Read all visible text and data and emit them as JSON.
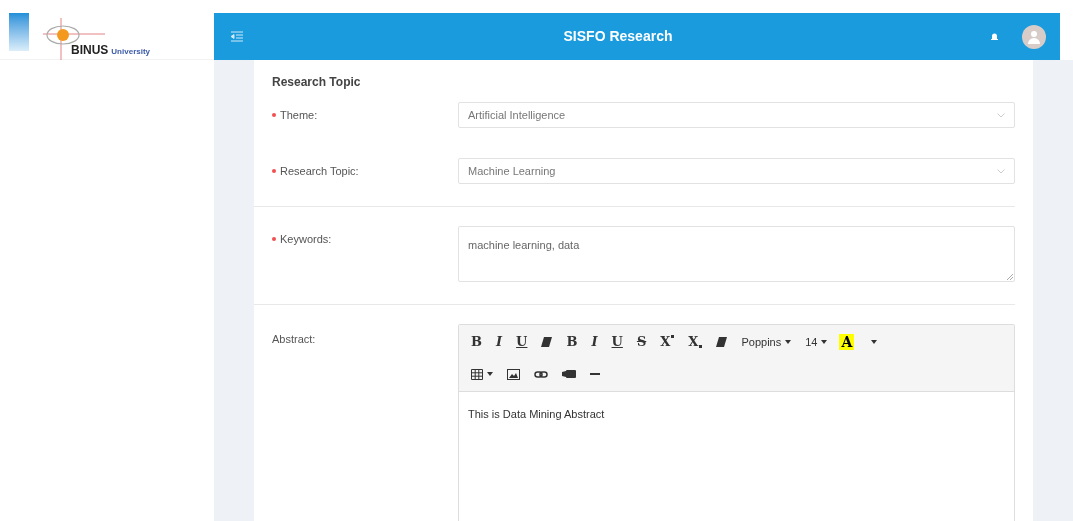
{
  "brand": {
    "name": "BINUS",
    "suffix": "University"
  },
  "header": {
    "title": "SISFO Research"
  },
  "section": {
    "title": "Research Topic"
  },
  "fields": [
    {
      "kind": "select",
      "label": "Theme:",
      "required": true,
      "value": "Artificial Intelligence",
      "divider_after": false
    },
    {
      "kind": "select",
      "label": "Research Topic:",
      "required": true,
      "value": "Machine Learning",
      "divider_after": true
    },
    {
      "kind": "textarea",
      "label": "Keywords:",
      "required": true,
      "value": "machine learning, data",
      "divider_after": true
    },
    {
      "kind": "editor",
      "label": "Abstract:",
      "required": false,
      "value": "This is Data Mining Abstract"
    }
  ],
  "toolbar": [
    [
      {
        "kind": "bold",
        "label": "B"
      },
      {
        "kind": "italic",
        "label": "I"
      },
      {
        "kind": "underline",
        "label": "U"
      },
      {
        "kind": "eraser"
      },
      {
        "kind": "bold",
        "label": "B"
      },
      {
        "kind": "italic",
        "label": "I"
      },
      {
        "kind": "underline",
        "label": "U"
      },
      {
        "kind": "strike",
        "label": "S"
      },
      {
        "kind": "superscript",
        "label": "X"
      },
      {
        "kind": "subscript",
        "label": "X"
      },
      {
        "kind": "eraser"
      },
      {
        "kind": "dropdown",
        "label": "Poppins"
      },
      {
        "kind": "dropdown",
        "label": "14"
      },
      {
        "kind": "color",
        "label": "A",
        "color": "#ffff00"
      }
    ],
    [
      {
        "kind": "table"
      },
      {
        "kind": "image"
      },
      {
        "kind": "link"
      },
      {
        "kind": "video"
      },
      {
        "kind": "rule"
      }
    ]
  ]
}
